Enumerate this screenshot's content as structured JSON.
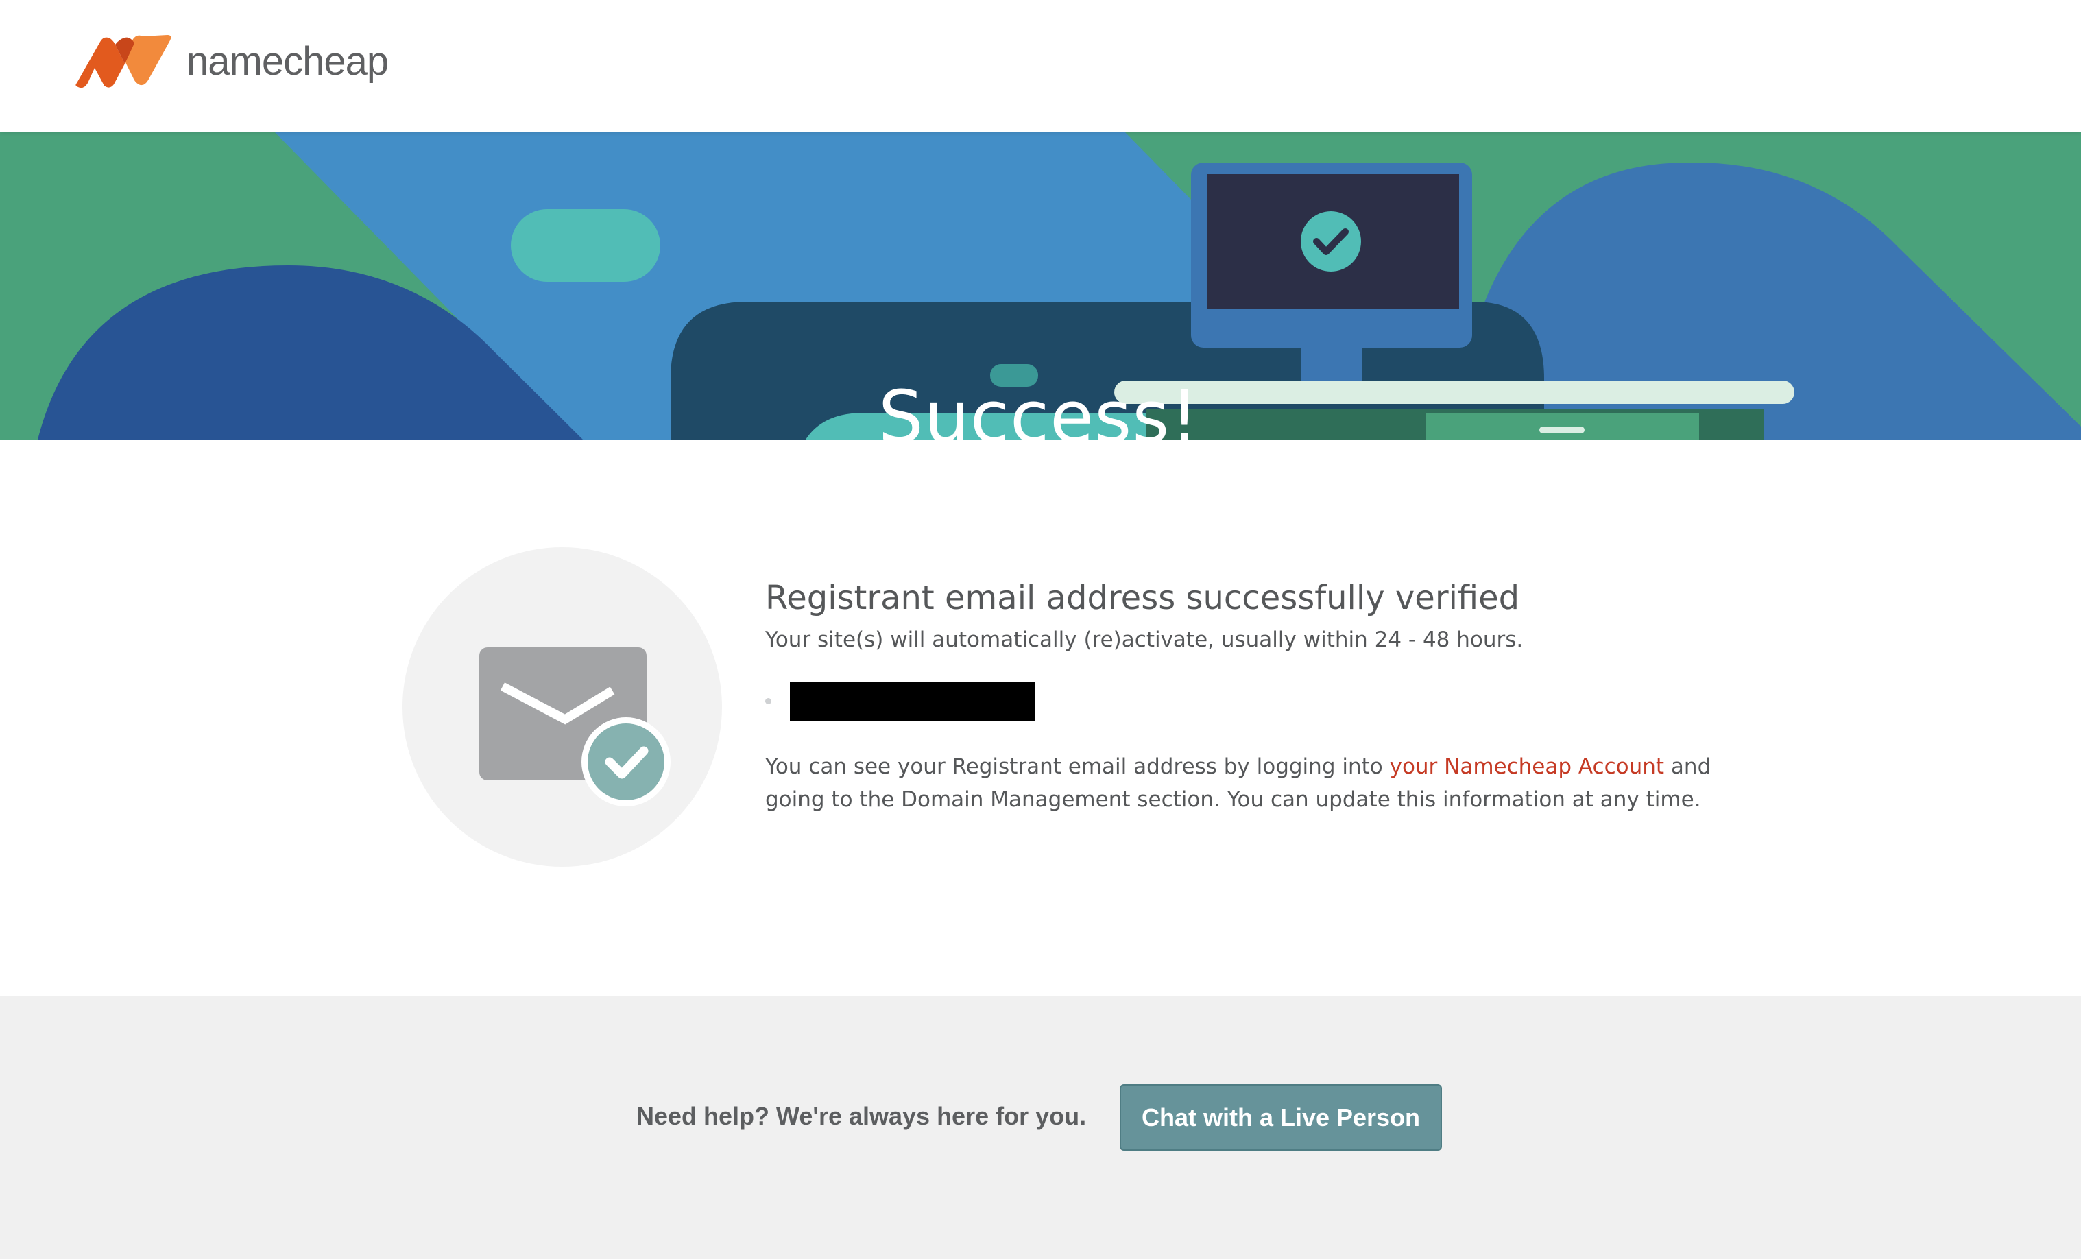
{
  "header": {
    "logo_text": "namecheap",
    "logo_icon": "namecheap-n-logo-icon"
  },
  "hero": {
    "title": "Success!",
    "illustration_icon": "monitor-checkmark-icon"
  },
  "main": {
    "heading": "Registrant email address successfully verified",
    "subtext": "Your site(s) will automatically (re)activate, usually within 24 - 48 hours.",
    "illustration_icon": "email-verified-icon",
    "domains_redacted": true,
    "info_before": "You can see your Registrant email address by logging into ",
    "info_link": "your Namecheap Account",
    "info_after": " and going to the Domain Management section. You can update this information at any time."
  },
  "footer": {
    "help_text": "Need help? We're always here for you.",
    "chat_button": "Chat with a Live Person"
  },
  "colors": {
    "brand_orange": "#f26b21",
    "link_red": "#c53a24",
    "hero_green": "#4aa27b",
    "hero_blue": "#438ec7",
    "chat_button": "#66939a",
    "footer_bg": "#f0f0f0"
  }
}
